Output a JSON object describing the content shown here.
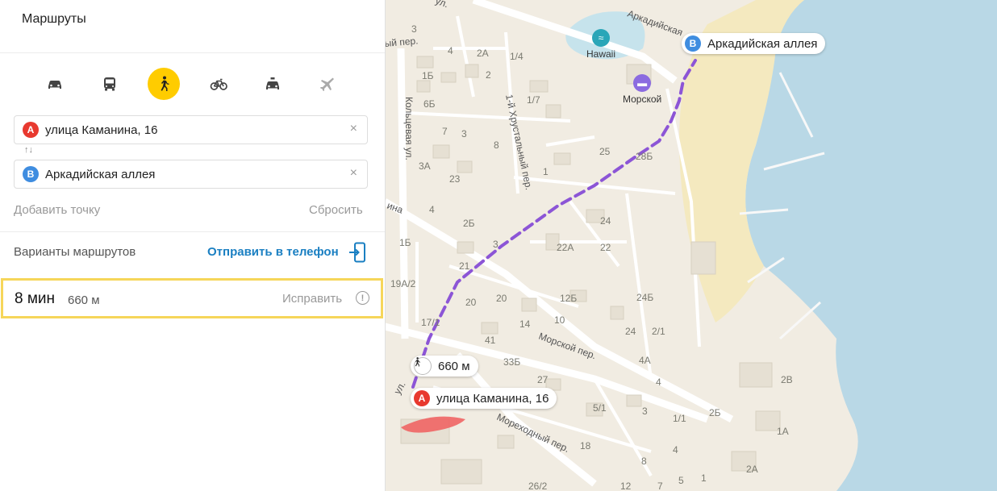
{
  "panel": {
    "title": "Маршруты",
    "modes": [
      {
        "name": "car-mode-icon",
        "active": false
      },
      {
        "name": "bus-mode-icon",
        "active": false
      },
      {
        "name": "walk-mode-icon",
        "active": true
      },
      {
        "name": "bike-mode-icon",
        "active": false
      },
      {
        "name": "taxi-mode-icon",
        "active": false
      },
      {
        "name": "plane-mode-icon",
        "active": false
      }
    ],
    "from": {
      "marker": "A",
      "value": "улица Каманина, 16"
    },
    "to": {
      "marker": "B",
      "value": "Аркадийская аллея"
    },
    "swap_label": "↑↓",
    "clear_label": "×",
    "add_point": "Добавить точку",
    "reset": "Сбросить",
    "variants_label": "Варианты маршрутов",
    "send_to_phone": "Отправить в телефон",
    "route": {
      "time": "8 мин",
      "distance": "660 м",
      "fix": "Исправить",
      "info": "!"
    }
  },
  "map": {
    "start_label": "улица Каманина, 16",
    "start_marker": "A",
    "end_label": "Аркадийская аллея",
    "end_marker": "B",
    "walk_distance": "660 м",
    "pois": [
      {
        "label": "Hawaii"
      },
      {
        "label": "Морской"
      }
    ],
    "streets": [
      {
        "id": "s1",
        "text": "Кольцевая ул."
      },
      {
        "id": "s2",
        "text": "1-й Хрустальный пер."
      },
      {
        "id": "s3",
        "text": "Морской пер."
      },
      {
        "id": "s4",
        "text": "Мореходный пер."
      },
      {
        "id": "s5",
        "text": "Аркадийская"
      },
      {
        "id": "s6",
        "text": "ый пер."
      },
      {
        "id": "s7",
        "text": "ина"
      },
      {
        "id": "s8",
        "text": "ул."
      },
      {
        "id": "s9",
        "text": "ул."
      }
    ],
    "house_numbers": [
      {
        "id": "h1",
        "text": "3"
      },
      {
        "id": "h2",
        "text": "4"
      },
      {
        "id": "h3",
        "text": "2А"
      },
      {
        "id": "h4",
        "text": "1/4"
      },
      {
        "id": "h5",
        "text": "1Б"
      },
      {
        "id": "h6",
        "text": "2"
      },
      {
        "id": "h7",
        "text": "6Б"
      },
      {
        "id": "h8",
        "text": "1/7"
      },
      {
        "id": "h9",
        "text": "7"
      },
      {
        "id": "h10",
        "text": "3"
      },
      {
        "id": "h11",
        "text": "8"
      },
      {
        "id": "h12",
        "text": "3А"
      },
      {
        "id": "h13",
        "text": "23"
      },
      {
        "id": "h14",
        "text": "1"
      },
      {
        "id": "h15",
        "text": "25"
      },
      {
        "id": "h16",
        "text": "28Б"
      },
      {
        "id": "h17",
        "text": "4"
      },
      {
        "id": "h18",
        "text": "2Б"
      },
      {
        "id": "h19",
        "text": "24"
      },
      {
        "id": "h20",
        "text": "1Б"
      },
      {
        "id": "h21",
        "text": "3"
      },
      {
        "id": "h22",
        "text": "22А"
      },
      {
        "id": "h23",
        "text": "22"
      },
      {
        "id": "h24",
        "text": "21"
      },
      {
        "id": "h25",
        "text": "19А/2"
      },
      {
        "id": "h26",
        "text": "20"
      },
      {
        "id": "h27",
        "text": "20"
      },
      {
        "id": "h28",
        "text": "12Б"
      },
      {
        "id": "h29",
        "text": "24Б"
      },
      {
        "id": "h30",
        "text": "10"
      },
      {
        "id": "h31",
        "text": "17/1"
      },
      {
        "id": "h32",
        "text": "14"
      },
      {
        "id": "h33",
        "text": "24"
      },
      {
        "id": "h34",
        "text": "2/1"
      },
      {
        "id": "h35",
        "text": "41"
      },
      {
        "id": "h36",
        "text": "33Б"
      },
      {
        "id": "h37",
        "text": "4А"
      },
      {
        "id": "h38",
        "text": "27"
      },
      {
        "id": "h39",
        "text": "4"
      },
      {
        "id": "h40",
        "text": "2В"
      },
      {
        "id": "h41",
        "text": "5/1"
      },
      {
        "id": "h42",
        "text": "3"
      },
      {
        "id": "h43",
        "text": "2Б"
      },
      {
        "id": "h44",
        "text": "1/1"
      },
      {
        "id": "h45",
        "text": "1А"
      },
      {
        "id": "h46",
        "text": "18"
      },
      {
        "id": "h47",
        "text": "4"
      },
      {
        "id": "h48",
        "text": "8"
      },
      {
        "id": "h49",
        "text": "2А"
      },
      {
        "id": "h50",
        "text": "26/2"
      },
      {
        "id": "h51",
        "text": "12"
      },
      {
        "id": "h52",
        "text": "7"
      },
      {
        "id": "h53",
        "text": "5"
      },
      {
        "id": "h54",
        "text": "1"
      }
    ]
  },
  "colors": {
    "accent_yellow": "#ffcc00",
    "link_blue": "#1a7fc2",
    "route_purple": "#8c55d6",
    "marker_red": "#e8392f",
    "marker_blue": "#3f8de0",
    "sea": "#b9d8e6",
    "beach": "#f4e9bf",
    "card_border": "#f6d65a"
  }
}
